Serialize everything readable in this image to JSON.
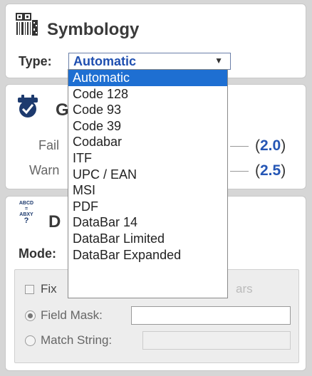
{
  "symbology": {
    "title": "Symbology",
    "type_label": "Type:",
    "selected": "Automatic",
    "options": [
      "Automatic",
      "Code 128",
      "Code 93",
      "Code 39",
      "Codabar",
      "ITF",
      "UPC / EAN",
      "MSI",
      "PDF",
      "DataBar 14",
      "DataBar Limited",
      "DataBar Expanded"
    ]
  },
  "grade": {
    "title_visible": "G",
    "fail_label": "Fail",
    "fail_value": "2.0",
    "warn_label": "Warn",
    "warn_value": "2.5"
  },
  "decode": {
    "title_visible": "D",
    "mode_label": "Mode:",
    "fixed_label_visible": "Fix",
    "fixed_suffix_visible": "ars",
    "field_mask_label": "Field Mask:",
    "field_mask_value": "",
    "match_string_label": "Match String:",
    "match_string_value": ""
  },
  "colors": {
    "accent": "#1e6fd2",
    "value_blue": "#2556b5"
  }
}
